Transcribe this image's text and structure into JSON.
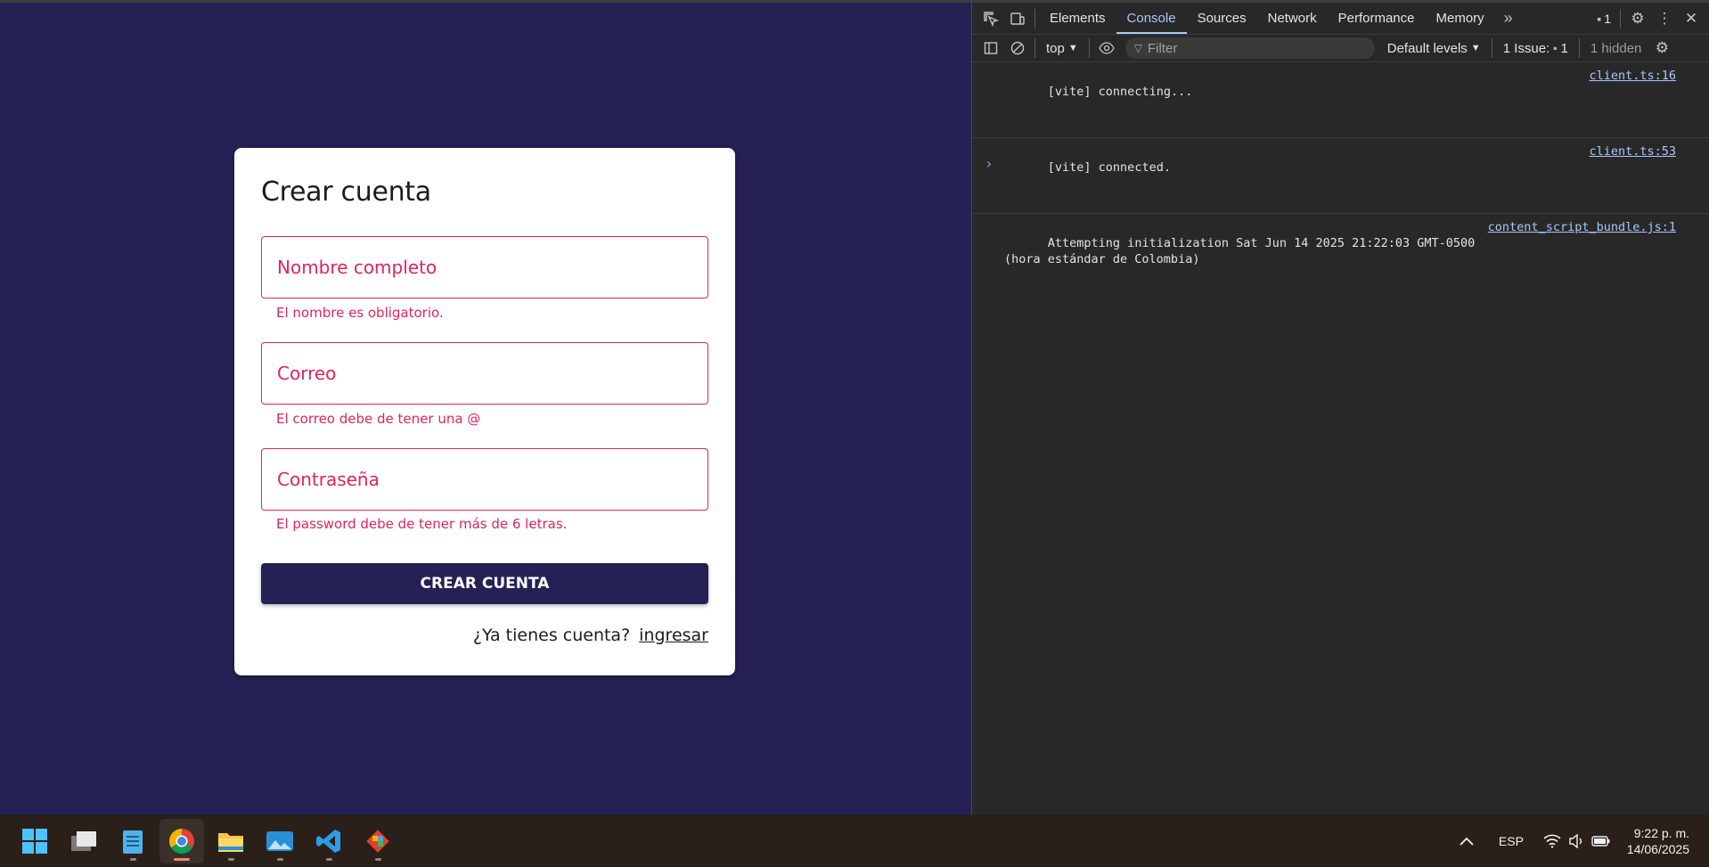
{
  "form": {
    "title": "Crear cuenta",
    "fields": [
      {
        "label": "Nombre completo",
        "error": "El nombre es obligatorio."
      },
      {
        "label": "Correo",
        "error": "El correo debe de tener una @"
      },
      {
        "label": "Contraseña",
        "error": "El password debe de tener más de 6 letras."
      }
    ],
    "submit_label": "CREAR CUENTA",
    "login_prompt": "¿Ya tienes cuenta?",
    "login_link": "ingresar",
    "error_color": "#e0245e",
    "accent_color": "#262155"
  },
  "devtools": {
    "tabs": [
      "Elements",
      "Console",
      "Sources",
      "Network",
      "Performance",
      "Memory"
    ],
    "active_tab": "Console",
    "messages_badge": "1",
    "context": "top",
    "filter_placeholder": "Filter",
    "levels": "Default levels",
    "issues_label": "1 Issue:",
    "issues_count": "1",
    "hidden": "1 hidden",
    "console": [
      {
        "text": "[vite] connecting...",
        "source": "client.ts:16"
      },
      {
        "text": "[vite] connected.",
        "source": "client.ts:53"
      },
      {
        "text": "Attempting initialization Sat Jun 14 2025 21:22:03 GMT-0500\n(hora estándar de Colombia)",
        "source": "content_script_bundle.js:1"
      }
    ]
  },
  "taskbar": {
    "apps": [
      "start-icon",
      "task-view-icon",
      "notepad-icon",
      "chrome-icon",
      "file-explorer-icon",
      "photos-icon",
      "vscode-icon",
      "git-icon"
    ],
    "language": "ESP",
    "time": "9:22 p. m.",
    "date": "14/06/2025"
  }
}
